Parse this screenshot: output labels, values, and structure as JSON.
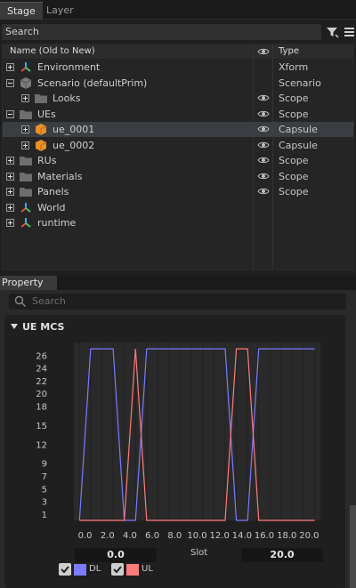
{
  "stage": {
    "tabs": [
      "Stage",
      "Layer"
    ],
    "search_placeholder": "Search",
    "col_name": "Name (Old to New)",
    "col_type": "Type",
    "rows": [
      {
        "label": "Environment",
        "type": "Xform",
        "icon": "xform-icon"
      },
      {
        "label": "Scenario (defaultPrim)",
        "type": "Scenario",
        "icon": "cube-icon"
      },
      {
        "label": "Looks",
        "type": "Scope",
        "icon": "folder-icon"
      },
      {
        "label": "UEs",
        "type": "Scope",
        "icon": "folder-icon"
      },
      {
        "label": "ue_0001",
        "type": "Capsule",
        "icon": "capsule-icon"
      },
      {
        "label": "ue_0002",
        "type": "Capsule",
        "icon": "capsule-icon"
      },
      {
        "label": "RUs",
        "type": "Scope",
        "icon": "folder-icon"
      },
      {
        "label": "Materials",
        "type": "Scope",
        "icon": "folder-icon"
      },
      {
        "label": "Panels",
        "type": "Scope",
        "icon": "folder-icon"
      },
      {
        "label": "World",
        "type": "",
        "icon": "xform-icon"
      },
      {
        "label": "runtime",
        "type": "",
        "icon": "xform-icon"
      }
    ]
  },
  "property": {
    "tab": "Property",
    "search_placeholder": "Search",
    "section_title": "UE MCS",
    "x_min_field": "0.0",
    "x_max_field": "20.0",
    "x_axis_label": "Slot",
    "legend": [
      {
        "name": "DL",
        "color": "#7b7bff"
      },
      {
        "name": "UL",
        "color": "#ff7b7b"
      }
    ]
  },
  "chart_data": {
    "type": "line",
    "xlabel": "Slot",
    "ylabel": "",
    "xlim": [
      -1,
      21
    ],
    "ylim": [
      0,
      28
    ],
    "xticks": [
      "0.0",
      "2.0",
      "4.0",
      "6.0",
      "8.0",
      "10.0",
      "12.0",
      "14.0",
      "16.0",
      "18.0",
      "20.0"
    ],
    "yticks": [
      "1",
      "3",
      "5",
      "7",
      "9",
      "12",
      "15",
      "18",
      "20",
      "22",
      "24",
      "26"
    ],
    "series": [
      {
        "name": "DL",
        "color": "#7b7bff",
        "x": [
          -0.5,
          0.5,
          1.5,
          2.5,
          3.5,
          4.5,
          5.5,
          6.5,
          7.5,
          8.5,
          9.5,
          10.5,
          11.5,
          12.5,
          13.5,
          14.5,
          15.5,
          16.5,
          17.5,
          18.5,
          19.5,
          20.5
        ],
        "y": [
          0,
          27,
          27,
          27,
          0,
          0,
          27,
          27,
          27,
          27,
          27,
          27,
          27,
          27,
          0,
          0,
          27,
          27,
          27,
          27,
          27,
          27
        ]
      },
      {
        "name": "UL",
        "color": "#ff7b7b",
        "x": [
          -0.5,
          0.5,
          1.5,
          2.5,
          3.5,
          4.5,
          5.5,
          6.5,
          7.5,
          8.5,
          9.5,
          10.5,
          11.5,
          12.5,
          13.5,
          14.5,
          15.5,
          16.5,
          17.5,
          18.5,
          19.5,
          20.5
        ],
        "y": [
          0,
          0,
          0,
          0,
          0,
          27,
          0,
          0,
          0,
          0,
          0,
          0,
          0,
          0,
          27,
          27,
          0,
          0,
          0,
          0,
          0,
          0
        ]
      }
    ]
  }
}
